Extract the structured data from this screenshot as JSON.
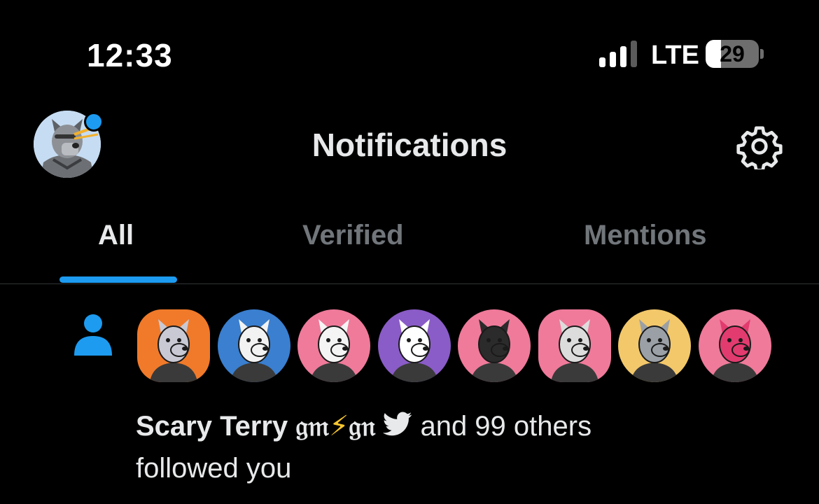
{
  "status_bar": {
    "time": "12:33",
    "network": "LTE",
    "battery_level": "29",
    "battery_fraction": 0.29,
    "signal_bars": 3,
    "signal_max": 4
  },
  "header": {
    "title": "Notifications",
    "profile_icon": "profile-avatar-icon",
    "settings_icon": "gear-icon",
    "profile_dot_color": "#1d9bf0"
  },
  "tabs": [
    {
      "label": "All",
      "active": true
    },
    {
      "label": "Verified",
      "active": false
    },
    {
      "label": "Mentions",
      "active": false
    }
  ],
  "notification": {
    "icon": "person-icon",
    "name_prefix": "Scary Terry ",
    "name_gm": "𝔤𝔪",
    "bolt": "⚡",
    "name_gn": "𝔤𝔫",
    "verified_icon": "twitter-bird-icon",
    "rest": " and 99 others",
    "line2": "followed you",
    "avatars": [
      {
        "bg": "#f07a2a",
        "fur": "#c9c9d4",
        "shape": "hex"
      },
      {
        "bg": "#3a7fd0",
        "fur": "#f2f2f2",
        "shape": "circle"
      },
      {
        "bg": "#ef7a9a",
        "fur": "#f4f4f4",
        "shape": "circle"
      },
      {
        "bg": "#8a5cc7",
        "fur": "#ffffff",
        "shape": "circle"
      },
      {
        "bg": "#ef7a9a",
        "fur": "#2b2b2b",
        "shape": "circle"
      },
      {
        "bg": "#ef7a9a",
        "fur": "#dcdcdc",
        "shape": "hex"
      },
      {
        "bg": "#f3c86a",
        "fur": "#9aa0a6",
        "shape": "circle"
      },
      {
        "bg": "#ef7a9a",
        "fur": "#e23b6f",
        "shape": "circle"
      }
    ]
  },
  "colors": {
    "accent": "#1d9bf0",
    "background": "#000000",
    "text": "#e7e9ea",
    "muted": "#71767b"
  }
}
